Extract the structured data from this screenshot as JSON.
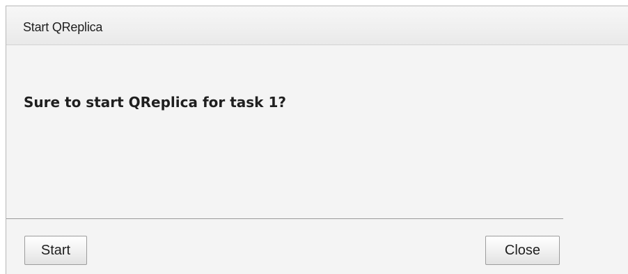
{
  "dialog": {
    "title": "Start QReplica",
    "message": "Sure to start QReplica for task 1?",
    "buttons": {
      "start_label": "Start",
      "close_label": "Close"
    }
  },
  "colors": {
    "titlebar_bg": "#efefef",
    "dialog_bg": "#f4f4f4",
    "divider": "#9a9a9a",
    "button_border": "#9c9c9c",
    "text": "#1e1e1e"
  }
}
